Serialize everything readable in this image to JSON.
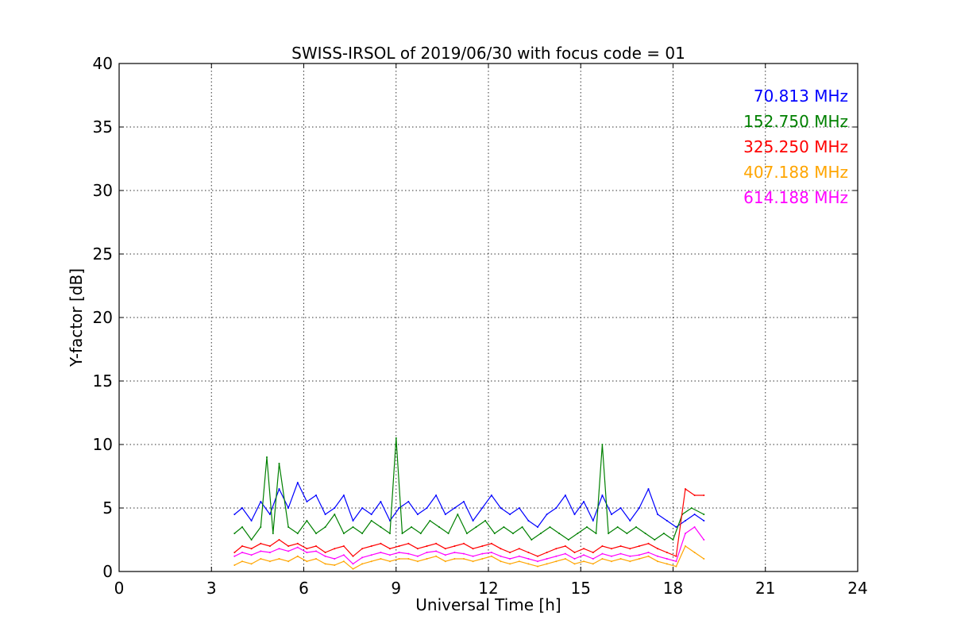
{
  "chart_data": {
    "type": "line",
    "title": "SWISS-IRSOL of 2019/06/30 with focus code = 01",
    "xlabel": "Universal Time [h]",
    "ylabel": "Y-factor [dB]",
    "xlim": [
      0,
      24
    ],
    "ylim": [
      0,
      40
    ],
    "xticks": [
      0,
      3,
      6,
      9,
      12,
      15,
      18,
      21,
      24
    ],
    "yticks": [
      0,
      5,
      10,
      15,
      20,
      25,
      30,
      35,
      40
    ],
    "grid": true,
    "legend_position": "top-right",
    "series": [
      {
        "name": "70.813 MHz",
        "color": "#0000ff",
        "x": [
          3.75,
          4.0,
          4.3,
          4.6,
          4.9,
          5.2,
          5.5,
          5.8,
          6.1,
          6.4,
          6.7,
          7.0,
          7.3,
          7.6,
          7.9,
          8.2,
          8.5,
          8.8,
          9.1,
          9.4,
          9.7,
          10.0,
          10.3,
          10.6,
          10.9,
          11.2,
          11.5,
          11.8,
          12.1,
          12.4,
          12.7,
          13.0,
          13.3,
          13.6,
          13.9,
          14.2,
          14.5,
          14.8,
          15.1,
          15.4,
          15.7,
          16.0,
          16.3,
          16.6,
          16.9,
          17.2,
          17.5,
          17.8,
          18.1,
          18.4,
          18.7,
          19.0
        ],
        "y": [
          4.5,
          5.0,
          4.0,
          5.5,
          4.5,
          6.5,
          5.0,
          7.0,
          5.5,
          6.0,
          4.5,
          5.0,
          6.0,
          4.0,
          5.0,
          4.5,
          5.5,
          4.0,
          5.0,
          5.5,
          4.5,
          5.0,
          6.0,
          4.5,
          5.0,
          5.5,
          4.0,
          5.0,
          6.0,
          5.0,
          4.5,
          5.0,
          4.0,
          3.5,
          4.5,
          5.0,
          6.0,
          4.5,
          5.5,
          4.0,
          6.0,
          4.5,
          5.0,
          4.0,
          5.0,
          6.5,
          4.5,
          4.0,
          3.5,
          4.0,
          4.5,
          4.0
        ]
      },
      {
        "name": "152.750 MHz",
        "color": "#008000",
        "x": [
          3.75,
          4.0,
          4.3,
          4.6,
          4.8,
          5.0,
          5.2,
          5.5,
          5.8,
          6.1,
          6.4,
          6.7,
          7.0,
          7.3,
          7.6,
          7.9,
          8.2,
          8.5,
          8.8,
          9.0,
          9.2,
          9.5,
          9.8,
          10.1,
          10.4,
          10.7,
          11.0,
          11.3,
          11.6,
          11.9,
          12.2,
          12.5,
          12.8,
          13.1,
          13.4,
          13.7,
          14.0,
          14.3,
          14.6,
          14.9,
          15.2,
          15.5,
          15.7,
          15.9,
          16.2,
          16.5,
          16.8,
          17.1,
          17.4,
          17.7,
          18.0,
          18.3,
          18.6,
          19.0
        ],
        "y": [
          3.0,
          3.5,
          2.5,
          3.5,
          9.0,
          3.0,
          8.5,
          3.5,
          3.0,
          4.0,
          3.0,
          3.5,
          4.5,
          3.0,
          3.5,
          3.0,
          4.0,
          3.5,
          3.0,
          10.5,
          3.0,
          3.5,
          3.0,
          4.0,
          3.5,
          3.0,
          4.5,
          3.0,
          3.5,
          4.0,
          3.0,
          3.5,
          3.0,
          3.5,
          2.5,
          3.0,
          3.5,
          3.0,
          2.5,
          3.0,
          3.5,
          3.0,
          10.0,
          3.0,
          3.5,
          3.0,
          3.5,
          3.0,
          2.5,
          3.0,
          2.5,
          4.5,
          5.0,
          4.5
        ]
      },
      {
        "name": "325.250 MHz",
        "color": "#ff0000",
        "x": [
          3.75,
          4.0,
          4.3,
          4.6,
          4.9,
          5.2,
          5.5,
          5.8,
          6.1,
          6.4,
          6.7,
          7.0,
          7.3,
          7.6,
          7.9,
          8.2,
          8.5,
          8.8,
          9.1,
          9.4,
          9.7,
          10.0,
          10.3,
          10.6,
          10.9,
          11.2,
          11.5,
          11.8,
          12.1,
          12.4,
          12.7,
          13.0,
          13.3,
          13.6,
          13.9,
          14.2,
          14.5,
          14.8,
          15.1,
          15.4,
          15.7,
          16.0,
          16.3,
          16.6,
          16.9,
          17.2,
          17.5,
          17.8,
          18.1,
          18.4,
          18.7,
          19.0
        ],
        "y": [
          1.5,
          2.0,
          1.8,
          2.2,
          2.0,
          2.5,
          2.0,
          2.2,
          1.8,
          2.0,
          1.5,
          1.8,
          2.0,
          1.2,
          1.8,
          2.0,
          2.2,
          1.8,
          2.0,
          2.2,
          1.8,
          2.0,
          2.2,
          1.8,
          2.0,
          2.2,
          1.8,
          2.0,
          2.2,
          1.8,
          1.5,
          1.8,
          1.5,
          1.2,
          1.5,
          1.8,
          2.0,
          1.5,
          1.8,
          1.5,
          2.0,
          1.8,
          2.0,
          1.8,
          2.0,
          2.2,
          1.8,
          1.5,
          1.2,
          6.5,
          6.0,
          6.0
        ]
      },
      {
        "name": "407.188 MHz",
        "color": "#ffa500",
        "x": [
          3.75,
          4.0,
          4.3,
          4.6,
          4.9,
          5.2,
          5.5,
          5.8,
          6.1,
          6.4,
          6.7,
          7.0,
          7.3,
          7.6,
          7.9,
          8.2,
          8.5,
          8.8,
          9.1,
          9.4,
          9.7,
          10.0,
          10.3,
          10.6,
          10.9,
          11.2,
          11.5,
          11.8,
          12.1,
          12.4,
          12.7,
          13.0,
          13.3,
          13.6,
          13.9,
          14.2,
          14.5,
          14.8,
          15.1,
          15.4,
          15.7,
          16.0,
          16.3,
          16.6,
          16.9,
          17.2,
          17.5,
          17.8,
          18.1,
          18.4,
          18.7,
          19.0
        ],
        "y": [
          0.5,
          0.8,
          0.6,
          1.0,
          0.8,
          1.0,
          0.8,
          1.2,
          0.8,
          1.0,
          0.6,
          0.5,
          0.8,
          0.2,
          0.6,
          0.8,
          1.0,
          0.8,
          1.0,
          1.0,
          0.8,
          1.0,
          1.2,
          0.8,
          1.0,
          1.0,
          0.8,
          1.0,
          1.2,
          0.8,
          0.6,
          0.8,
          0.6,
          0.4,
          0.6,
          0.8,
          1.0,
          0.6,
          0.8,
          0.6,
          1.0,
          0.8,
          1.0,
          0.8,
          1.0,
          1.2,
          0.8,
          0.6,
          0.4,
          2.0,
          1.5,
          1.0
        ]
      },
      {
        "name": "614.188 MHz",
        "color": "#ff00ff",
        "x": [
          3.75,
          4.0,
          4.3,
          4.6,
          4.9,
          5.2,
          5.5,
          5.8,
          6.1,
          6.4,
          6.7,
          7.0,
          7.3,
          7.6,
          7.9,
          8.2,
          8.5,
          8.8,
          9.1,
          9.4,
          9.7,
          10.0,
          10.3,
          10.6,
          10.9,
          11.2,
          11.5,
          11.8,
          12.1,
          12.4,
          12.7,
          13.0,
          13.3,
          13.6,
          13.9,
          14.2,
          14.5,
          14.8,
          15.1,
          15.4,
          15.7,
          16.0,
          16.3,
          16.6,
          16.9,
          17.2,
          17.5,
          17.8,
          18.1,
          18.4,
          18.7,
          19.0
        ],
        "y": [
          1.2,
          1.5,
          1.3,
          1.6,
          1.5,
          1.8,
          1.6,
          1.9,
          1.5,
          1.6,
          1.2,
          1.0,
          1.3,
          0.6,
          1.1,
          1.3,
          1.5,
          1.3,
          1.5,
          1.4,
          1.2,
          1.5,
          1.6,
          1.3,
          1.5,
          1.4,
          1.2,
          1.4,
          1.5,
          1.2,
          1.0,
          1.2,
          1.0,
          0.8,
          1.0,
          1.2,
          1.4,
          1.0,
          1.3,
          1.0,
          1.4,
          1.2,
          1.4,
          1.2,
          1.3,
          1.5,
          1.2,
          1.0,
          0.8,
          3.0,
          3.5,
          2.5
        ]
      }
    ]
  }
}
